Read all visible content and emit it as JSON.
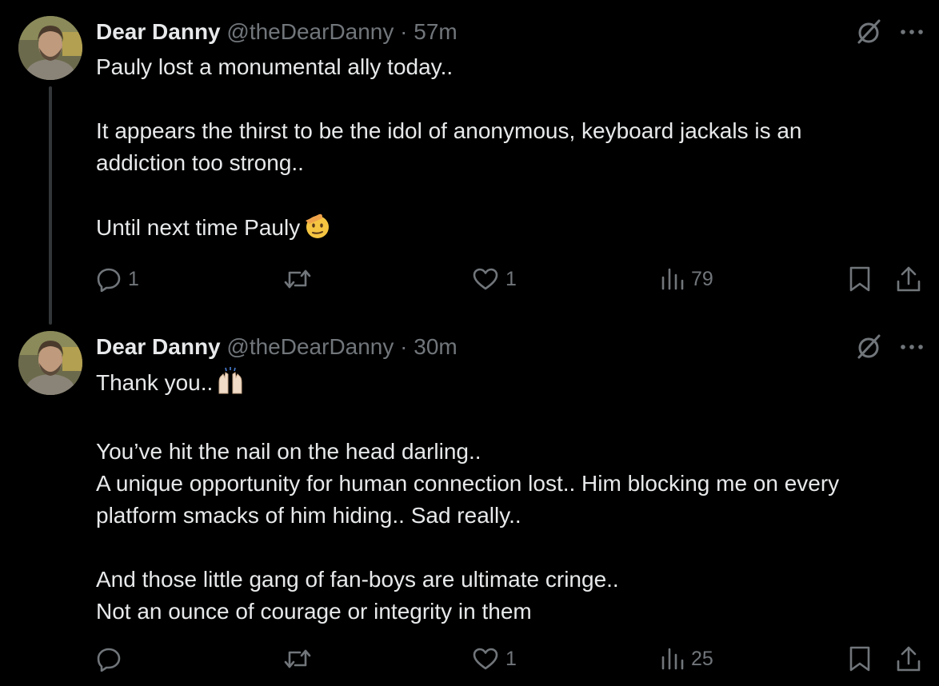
{
  "tweets": [
    {
      "author": "Dear Danny",
      "handle": "@theDearDanny",
      "separator": "·",
      "time": "57m",
      "lines": [
        "Pauly lost a monumental ally today..",
        "",
        "It appears the thirst to be the idol of anonymous, keyboard jackals is an",
        "addiction too strong..",
        "",
        "Until next time Pauly"
      ],
      "emoji": "saluting-face",
      "replies": "1",
      "retweets": "",
      "likes": "1",
      "views": "79"
    },
    {
      "author": "Dear Danny",
      "handle": "@theDearDanny",
      "separator": "·",
      "time": "30m",
      "lines": [
        "Thank you..",
        "",
        "You’ve hit the nail on the head darling..",
        "A unique opportunity for human connection lost.. Him blocking me on every",
        "platform smacks of him hiding.. Sad really..",
        "",
        "And those little gang of fan-boys are ultimate cringe..",
        "Not an ounce of courage or integrity in them"
      ],
      "emoji": "raising-hands",
      "replies": "",
      "retweets": "",
      "likes": "1",
      "views": "25"
    }
  ],
  "icons": {
    "top": [
      "grok-icon",
      "more-icon"
    ],
    "actions": [
      "reply-icon",
      "retweet-icon",
      "like-icon",
      "views-icon",
      "bookmark-icon",
      "share-icon"
    ]
  },
  "colors": {
    "background": "#000000",
    "text": "#e7e9ea",
    "secondary": "#71767b",
    "thread_line": "#333639"
  }
}
